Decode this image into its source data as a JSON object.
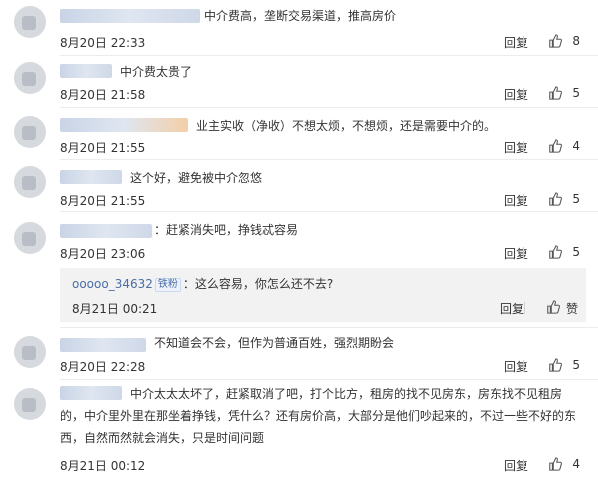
{
  "ui": {
    "reply_label": "回复",
    "sub_like_label": "赞",
    "like_icon": "thumbs-up-icon"
  },
  "comments": [
    {
      "text": "中介费高，垄断交易渠道，推高房价",
      "time": "8月20日 22:33",
      "likes": "8"
    },
    {
      "text": "中介费太贵了",
      "time": "8月20日 21:58",
      "likes": "5"
    },
    {
      "text": "业主实收（净收）不想太烦，不想烦，还是需要中介的。",
      "time": "8月20日 21:55",
      "likes": "4"
    },
    {
      "text": "这个好，避免被中介忽悠",
      "time": "8月20日 21:55",
      "likes": "5"
    },
    {
      "text": "：赶紧消失吧，挣钱忒容易",
      "time": "8月20日 23:06",
      "likes": "5",
      "sub": {
        "user": "ooooo_34632",
        "badge": "铁粉",
        "text": "：这么容易，你怎么还不去?",
        "time": "8月21日 00:21"
      }
    },
    {
      "text": "不知道会不会，但作为普通百姓，强烈期盼会",
      "time": "8月20日 22:28",
      "likes": "5"
    },
    {
      "text_lines": [
        "中介太太太坏了，赶紧取消了吧，打个比方，租房的找不见房东，房东找不见租房",
        "的，中介里外里在那坐着挣钱，凭什么？还有房价高，大部分是他们吵起来的，不过一些不好的东",
        "西，自然而然就会消失，只是时间问题"
      ],
      "time": "8月21日 00:12",
      "likes": "4"
    }
  ]
}
